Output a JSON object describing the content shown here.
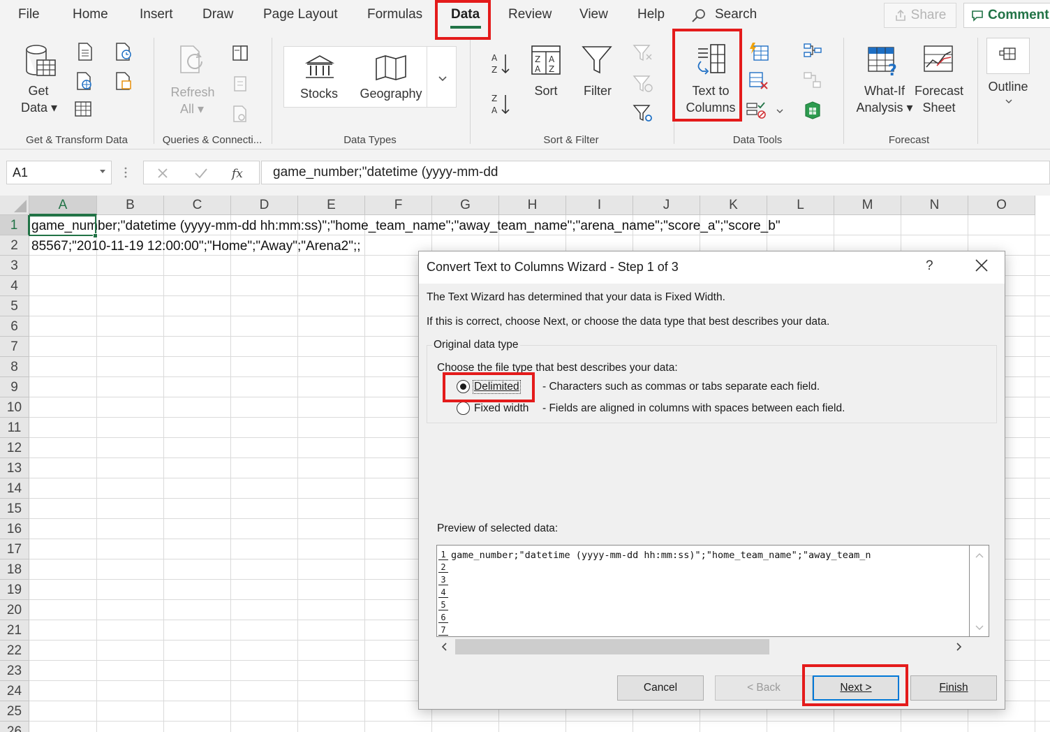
{
  "ribbon_tabs": [
    {
      "label": "File"
    },
    {
      "label": "Home"
    },
    {
      "label": "Insert"
    },
    {
      "label": "Draw"
    },
    {
      "label": "Page Layout"
    },
    {
      "label": "Formulas"
    },
    {
      "label": "Data"
    },
    {
      "label": "Review"
    },
    {
      "label": "View"
    },
    {
      "label": "Help"
    }
  ],
  "search_label": "Search",
  "share_label": "Share",
  "comment_label": "Comment",
  "groups": {
    "get_transform": {
      "label": "Get & Transform Data",
      "get_data": [
        "Get",
        "Data ▾"
      ]
    },
    "queries": {
      "label": "Queries & Connecti...",
      "refresh": [
        "Refresh",
        "All ▾"
      ]
    },
    "data_types": {
      "label": "Data Types",
      "stocks": "Stocks",
      "geography": "Geography"
    },
    "sort_filter": {
      "label": "Sort & Filter",
      "sort": "Sort",
      "filter": "Filter"
    },
    "data_tools": {
      "label": "Data Tools",
      "text_to_columns": [
        "Text to",
        "Columns"
      ]
    },
    "forecast": {
      "label": "Forecast",
      "what_if": [
        "What-If",
        "Analysis ▾"
      ],
      "forecast_sheet": [
        "Forecast",
        "Sheet"
      ]
    },
    "outline": {
      "label": "Outline"
    }
  },
  "name_box": "A1",
  "formula_value": "game_number;\"datetime (yyyy-mm-dd",
  "columns": [
    "A",
    "B",
    "C",
    "D",
    "E",
    "F",
    "G",
    "H",
    "I",
    "J",
    "K",
    "L",
    "M",
    "N",
    "O"
  ],
  "rows": [
    "1",
    "2",
    "3",
    "4",
    "5",
    "6",
    "7",
    "8",
    "9",
    "10",
    "11",
    "12",
    "13",
    "14",
    "15",
    "16",
    "17",
    "18",
    "19",
    "20",
    "21",
    "22",
    "23",
    "24",
    "25",
    "26"
  ],
  "cells": {
    "A1": "game_number;\"datetime (yyyy-mm-dd hh:mm:ss)\";\"home_team_name\";\"away_team_name\";\"arena_name\";\"score_a\";\"score_b\"",
    "A2": "85567;\"2010-11-19 12:00:00\";\"Home\";\"Away\";\"Arena2\";;"
  },
  "dialog": {
    "title": "Convert Text to Columns Wizard - Step 1 of 3",
    "help": "?",
    "intro1": "The Text Wizard has determined that your data is Fixed Width.",
    "intro2": "If this is correct, choose Next, or choose the data type that best describes your data.",
    "group_label": "Original data type",
    "choose_label": "Choose the file type that best describes your data:",
    "options": [
      {
        "label": "Delimited",
        "desc": "- Characters such as commas or tabs separate each field.",
        "selected": true
      },
      {
        "label": "Fixed width",
        "desc": "- Fields are aligned in columns with spaces between each field.",
        "selected": false
      }
    ],
    "preview_label": "Preview of selected data:",
    "preview_rows": [
      "1",
      "2",
      "3",
      "4",
      "5",
      "6",
      "7"
    ],
    "preview_line1": "game_number;\"datetime (yyyy-mm-dd hh:mm:ss)\";\"home_team_name\";\"away_team_n",
    "buttons": {
      "cancel": "Cancel",
      "back": "< Back",
      "next": "Next >",
      "finish": "Finish"
    }
  },
  "colors": {
    "accent_green": "#217346",
    "highlight_red": "#e41b1b",
    "focus_blue": "#0078d7"
  }
}
